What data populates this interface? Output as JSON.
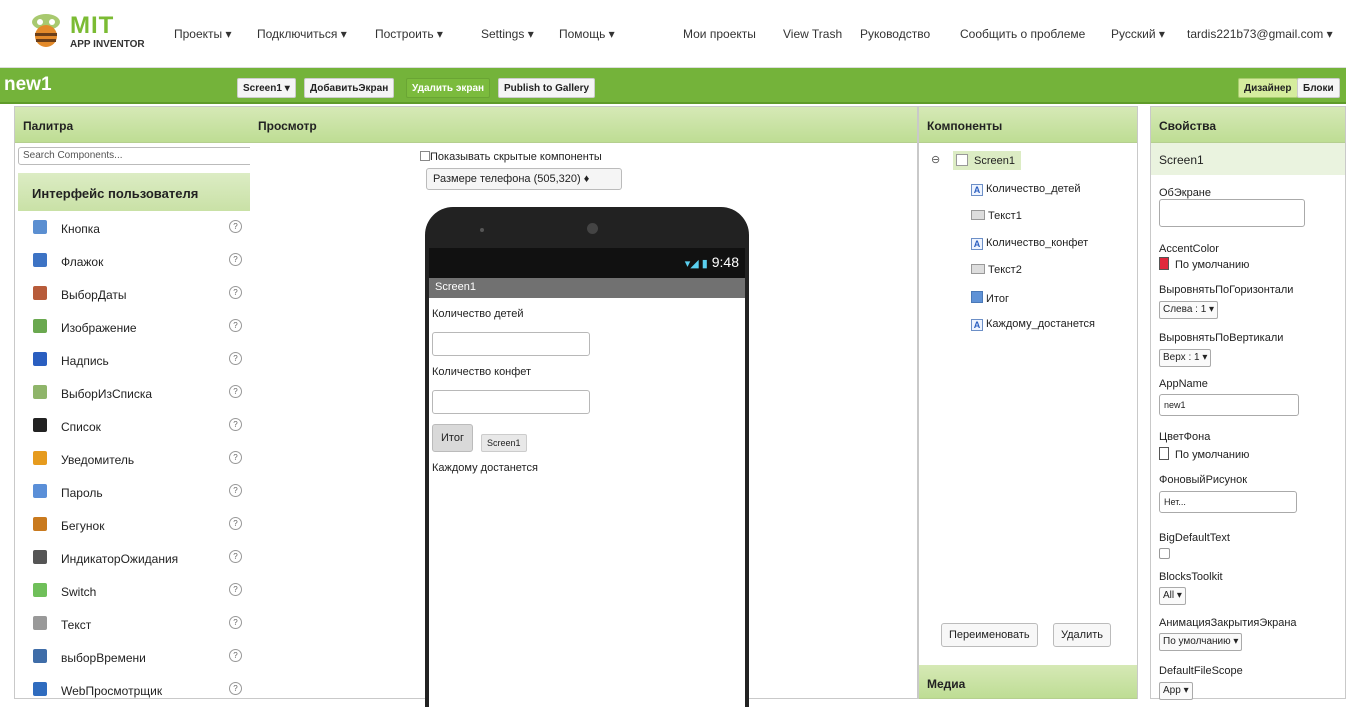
{
  "topbar": {
    "logo_title": "MIT",
    "logo_sub": "APP INVENTOR",
    "menus": [
      "Проекты ▾",
      "Подключиться ▾",
      "Построить ▾",
      "Settings ▾",
      "Помощь ▾"
    ],
    "links": [
      "Мои проекты",
      "View Trash",
      "Руководство",
      "Сообщить о проблеме",
      "Русский ▾",
      "tardis221b73@gmail.com ▾"
    ]
  },
  "toolbar": {
    "project": "new1",
    "screen_select": "Screen1 ▾",
    "add_screen": "ДобавитьЭкран",
    "remove_screen": "Удалить экран",
    "publish": "Publish to Gallery",
    "designer": "Дизайнер",
    "blocks": "Блоки"
  },
  "palette": {
    "title": "Палитра",
    "search_placeholder": "Search Components...",
    "category": "Интерфейс пользователя",
    "help": "?",
    "items": [
      {
        "label": "Кнопка",
        "color": "#5b8fd1",
        "icon": "button-icon"
      },
      {
        "label": "Флажок",
        "color": "#3d73c4",
        "icon": "checkbox-icon"
      },
      {
        "label": "ВыборДаты",
        "color": "#b75b3a",
        "icon": "datepicker-icon"
      },
      {
        "label": "Изображение",
        "color": "#6aa84f",
        "icon": "image-icon"
      },
      {
        "label": "Надпись",
        "color": "#2a5ec0",
        "icon": "label-icon"
      },
      {
        "label": "ВыборИзСписка",
        "color": "#8fb56a",
        "icon": "listpicker-icon"
      },
      {
        "label": "Список",
        "color": "#222222",
        "icon": "listview-icon"
      },
      {
        "label": "Уведомитель",
        "color": "#e69b1e",
        "icon": "notifier-icon"
      },
      {
        "label": "Пароль",
        "color": "#5a8fd8",
        "icon": "password-icon"
      },
      {
        "label": "Бегунок",
        "color": "#c97a1e",
        "icon": "slider-icon"
      },
      {
        "label": "ИндикаторОжидания",
        "color": "#555555",
        "icon": "spinner-icon"
      },
      {
        "label": "Switch",
        "color": "#6fbf5a",
        "icon": "switch-icon"
      },
      {
        "label": "Текст",
        "color": "#999999",
        "icon": "textbox-icon"
      },
      {
        "label": "выборВремени",
        "color": "#3f6da8",
        "icon": "timepicker-icon"
      },
      {
        "label": "WebПросмотрщик",
        "color": "#2f6cbf",
        "icon": "webviewer-icon"
      }
    ]
  },
  "viewer": {
    "title": "Просмотр",
    "show_hidden": "Показывать скрытые компоненты",
    "phone_size": "Размере телефона (505,320)  ♦",
    "time": "9:48",
    "signal": "▾◢ ▮",
    "screen_title": "Screen1",
    "label1": "Количество детей",
    "label2": "Количество конфет",
    "button": "Итог",
    "tooltip": "Screen1",
    "label3": "Каждому достанется"
  },
  "components": {
    "title": "Компоненты",
    "root": "Screen1",
    "collapse": "⊖",
    "items": [
      {
        "label": "Количество_детей",
        "type": "label"
      },
      {
        "label": "Текст1",
        "type": "text"
      },
      {
        "label": "Количество_конфет",
        "type": "label"
      },
      {
        "label": "Текст2",
        "type": "text"
      },
      {
        "label": "Итог",
        "type": "button"
      },
      {
        "label": "Каждому_достанется",
        "type": "label"
      }
    ],
    "rename": "Переименовать",
    "delete": "Удалить",
    "media": "Медиа"
  },
  "properties": {
    "title": "Свойства",
    "screen": "Screen1",
    "about": "ОбЭкране",
    "accent": "AccentColor",
    "accent_val": "По умолчанию",
    "accent_color": "#e0283c",
    "halign": "ВыровнятьПоГоризонтали",
    "halign_val": "Слева : 1 ▾",
    "valign": "ВыровнятьПоВертикали",
    "valign_val": "Верх : 1 ▾",
    "appname": "AppName",
    "appname_val": "new1",
    "bgcolor": "ЦветФона",
    "bgcolor_val": "По умолчанию",
    "bgimage": "ФоновыйРисунок",
    "bgimage_val": "Нет...",
    "bigtext": "BigDefaultText",
    "toolkit": "BlocksToolkit",
    "toolkit_val": "All ▾",
    "closeanim": "АнимацияЗакрытияЭкрана",
    "closeanim_val": "По умолчанию ▾",
    "filescope": "DefaultFileScope",
    "filescope_val": "App ▾"
  }
}
